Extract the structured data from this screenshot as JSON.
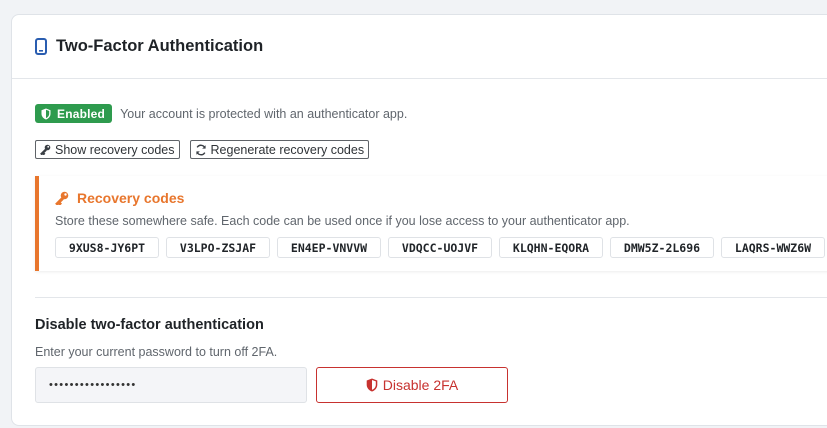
{
  "header": {
    "title": "Two-Factor Authentication",
    "icon": "mobile-phone-icon"
  },
  "status": {
    "badge": "Enabled",
    "badge_color": "#2e9b4e",
    "text": "Your account is protected with an authenticator app."
  },
  "actions": {
    "show_codes": "Show recovery codes",
    "regenerate_codes": "Regenerate recovery codes"
  },
  "recovery": {
    "title": "Recovery codes",
    "accent_color": "#e8762d",
    "description": "Store these somewhere safe. Each code can be used once if you lose access to your authenticator app.",
    "codes": [
      "9XUS8-JY6PT",
      "V3LPO-ZSJAF",
      "EN4EP-VNVVW",
      "VDQCC-UOJVF",
      "KLQHN-EQORA",
      "DMW5Z-2L696",
      "LAQRS-WWZ6W"
    ]
  },
  "disable": {
    "title": "Disable two-factor authentication",
    "description": "Enter your current password to turn off 2FA.",
    "password_value": "•••••••••••••••••",
    "button_label": "Disable 2FA",
    "danger_color": "#c7322f"
  }
}
